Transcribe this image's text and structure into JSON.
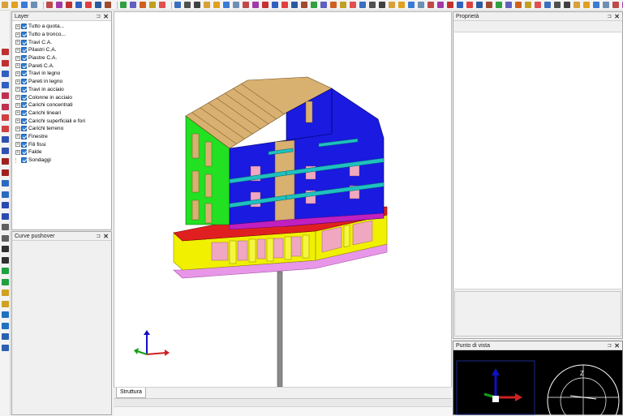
{
  "toolbar": {
    "buttons": [
      {
        "icon": "open-folder-icon",
        "color": "#d8a13a"
      },
      {
        "icon": "star-icon",
        "color": "#e0a020"
      },
      {
        "icon": "undo-icon",
        "color": "#3a7bd5"
      },
      {
        "icon": "hand-icon",
        "color": "#6d8fb4"
      },
      {
        "icon": "cube-icon",
        "color": "#c04a4a"
      },
      {
        "icon": "building-icon",
        "color": "#a13aa8"
      },
      {
        "icon": "wall-icon",
        "color": "#c43030"
      },
      {
        "icon": "beam-icon",
        "color": "#3060c0"
      },
      {
        "icon": "slab-icon",
        "color": "#e04040"
      },
      {
        "icon": "grid-icon",
        "color": "#2c5aa0"
      },
      {
        "icon": "stair-icon",
        "color": "#a04a30"
      },
      {
        "icon": "roof-icon",
        "color": "#30a040"
      },
      {
        "icon": "section-icon",
        "color": "#6060c0"
      },
      {
        "icon": "move-icon",
        "color": "#d06020"
      },
      {
        "icon": "snap-icon",
        "color": "#c0a020"
      },
      {
        "icon": "fill-icon",
        "color": "#e05050"
      },
      {
        "icon": "pin-icon",
        "color": "#3a70c0"
      },
      {
        "icon": "dimension-icon",
        "color": "#505050"
      },
      {
        "icon": "text-icon",
        "color": "#404040"
      }
    ]
  },
  "left_tools": [
    {
      "icon": "pillar-icon",
      "color": "#c03030"
    },
    {
      "icon": "beam-tool-icon",
      "color": "#3060c0"
    },
    {
      "icon": "wall-tool-icon",
      "color": "#c03050"
    },
    {
      "icon": "slab-tool-icon",
      "color": "#d04040"
    },
    {
      "icon": "load-tool-icon",
      "color": "#3050b0"
    },
    {
      "icon": "node-tool-icon",
      "color": "#a02020"
    },
    {
      "icon": "link-tool-icon",
      "color": "#2a6ac0"
    },
    {
      "icon": "rebar-icon",
      "color": "#2a4ab0"
    },
    {
      "icon": "sphere-icon",
      "color": "#606060"
    },
    {
      "icon": "arrow-down-icon",
      "color": "#303030"
    },
    {
      "icon": "support-icon",
      "color": "#20a040"
    },
    {
      "icon": "pencil-icon",
      "color": "#d0a020"
    },
    {
      "icon": "check-icon",
      "color": "#2070c0"
    },
    {
      "icon": "calc-icon",
      "color": "#2a60b0"
    }
  ],
  "layer_panel": {
    "title": "Layer",
    "pin": "⊐",
    "close": "✕",
    "items": [
      {
        "label": "Tutto a quota...",
        "expandable": true
      },
      {
        "label": "Tutto a tronco...",
        "expandable": true
      },
      {
        "label": "Travi C.A.",
        "expandable": true
      },
      {
        "label": "Pilastri C.A.",
        "expandable": true
      },
      {
        "label": "Piastre C.A.",
        "expandable": true
      },
      {
        "label": "Pareti C.A.",
        "expandable": true
      },
      {
        "label": "Travi in legno",
        "expandable": true
      },
      {
        "label": "Pareti in legno",
        "expandable": true
      },
      {
        "label": "Travi in acciaio",
        "expandable": true
      },
      {
        "label": "Colonne in acciaio",
        "expandable": true
      },
      {
        "label": "Carichi concentrati",
        "expandable": true
      },
      {
        "label": "Carichi lineari",
        "expandable": true
      },
      {
        "label": "Carichi superficiali e fori",
        "expandable": true
      },
      {
        "label": "Carichi terreno",
        "expandable": true
      },
      {
        "label": "Finestre",
        "expandable": true
      },
      {
        "label": "Fili fissi",
        "expandable": true
      },
      {
        "label": "Falde",
        "expandable": true
      },
      {
        "label": "Sondaggi",
        "expandable": false
      }
    ]
  },
  "pushover_panel": {
    "title": "Curve pushover",
    "pin": "⊐",
    "close": "✕"
  },
  "properties_panel": {
    "title": "Proprietà",
    "pin": "⊐",
    "close": "✕"
  },
  "viewpoint_panel": {
    "title": "Punto di vista",
    "pin": "⊐",
    "close": "✕",
    "axis_label": "Z"
  },
  "tabs": [
    {
      "label": "Struttura",
      "active": true
    }
  ],
  "colors": {
    "wall_blue": "#1a1ae0",
    "wall_green": "#22e022",
    "slab_yellow": "#f0f000",
    "beam_cyan": "#20c0c0",
    "wood": "#d8b070",
    "foundation_pink": "#e090e0",
    "opening_pink": "#f0a8c0",
    "slab_red": "#e02020",
    "pile_grey": "#808080"
  }
}
